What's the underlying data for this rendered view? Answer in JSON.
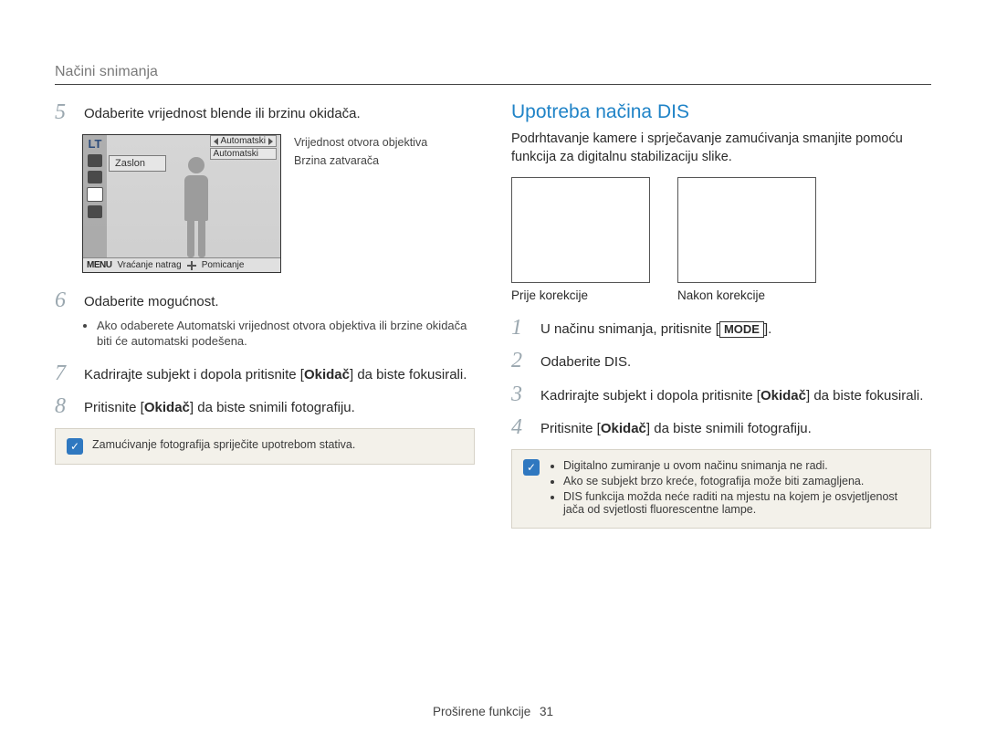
{
  "section_label": "Načini snimanja",
  "left": {
    "step5": {
      "num": "5",
      "text": "Odaberite vrijednost blende ili brzinu okidača."
    },
    "cam": {
      "lt": "LT",
      "popup": "Zaslon",
      "tag1": "Automatski",
      "tag2": "Automatski",
      "bottom_menu": "MENU",
      "bottom_back": "Vraćanje natrag",
      "bottom_move": "Pomicanje",
      "callout1": "Vrijednost otvora objektiva",
      "callout2": "Brzina zatvarača"
    },
    "step6": {
      "num": "6",
      "text": "Odaberite mogućnost.",
      "bullet": "Ako odaberete Automatski vrijednost otvora objektiva ili brzine okidača biti će automatski podešena."
    },
    "step7": {
      "num": "7",
      "text_pre": "Kadrirajte subjekt i dopola pritisnite [",
      "okidac": "Okidač",
      "text_post": "] da biste fokusirali."
    },
    "step8": {
      "num": "8",
      "text_pre": "Pritisnite [",
      "okidac": "Okidač",
      "text_post": "] da biste snimili fotografiju."
    },
    "tip_icon": "✓",
    "tip_text": "Zamućivanje fotografija spriječite upotrebom stativa."
  },
  "right": {
    "title": "Upotreba načina DIS",
    "intro": "Podrhtavanje kamere i sprječavanje zamućivanja smanjite pomoću funkcija za digitalnu stabilizaciju slike.",
    "before_label": "Prije korekcije",
    "after_label": "Nakon korekcije",
    "step1": {
      "num": "1",
      "text_pre": "U načinu snimanja, pritisnite [",
      "mode": "MODE",
      "text_post": "]."
    },
    "step2": {
      "num": "2",
      "text": "Odaberite DIS."
    },
    "step3": {
      "num": "3",
      "text_pre": "Kadrirajte subjekt i dopola pritisnite [",
      "okidac": "Okidač",
      "text_post": "] da biste fokusirali."
    },
    "step4": {
      "num": "4",
      "text_pre": "Pritisnite [",
      "okidac": "Okidač",
      "text_post": "] da biste snimili fotografiju."
    },
    "tip_icon": "✓",
    "tip_items": [
      "Digitalno zumiranje u ovom načinu snimanja ne radi.",
      "Ako se subjekt brzo kreće, fotografija može biti zamagljena.",
      "DIS funkcija možda neće raditi na mjestu na kojem je osvjetljenost jača od svjetlosti fluorescentne lampe."
    ]
  },
  "footer": {
    "label": "Proširene funkcije",
    "page": "31"
  }
}
